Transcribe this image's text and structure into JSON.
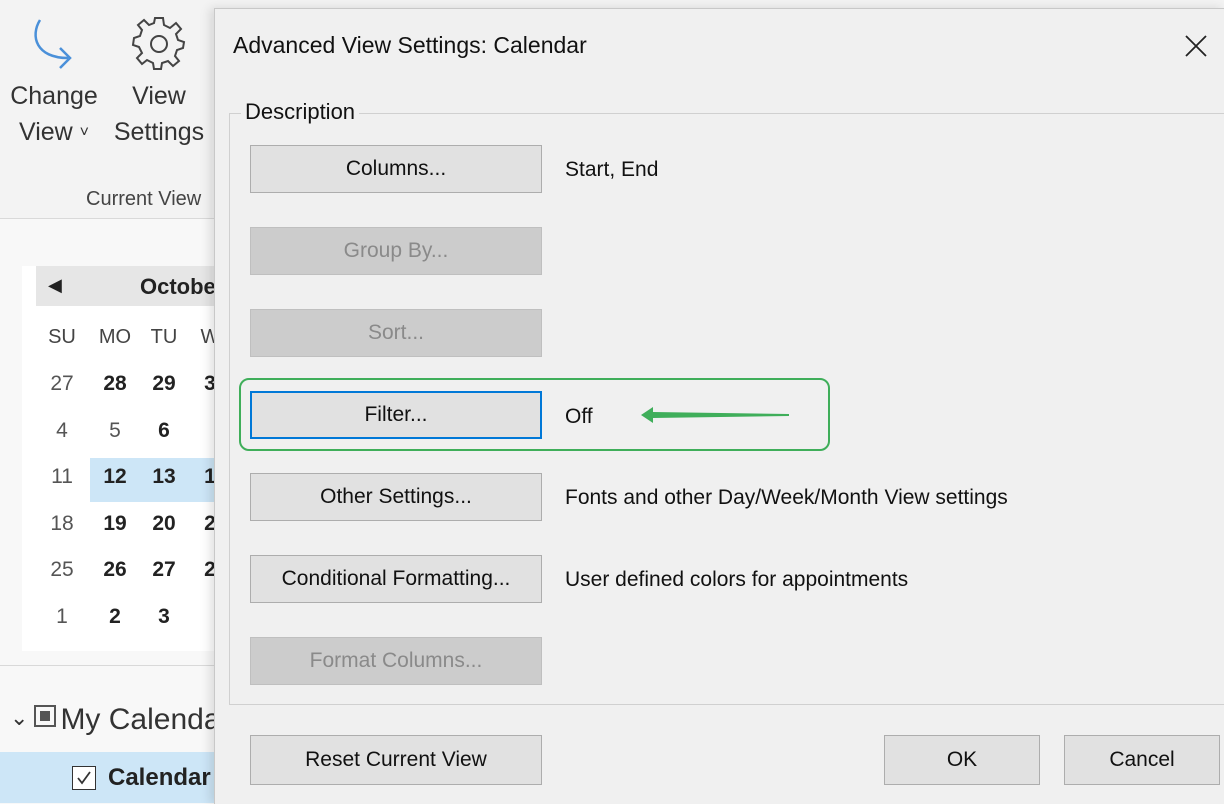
{
  "ribbon": {
    "change_view": {
      "line1": "Change",
      "line2": "View",
      "icon": "curved-arrow-icon"
    },
    "view_settings": {
      "line1": "View",
      "line2": "Settings",
      "icon": "gear-icon"
    },
    "group_label": "Current View"
  },
  "calendar": {
    "month": "October",
    "weekdays": [
      "SU",
      "MO",
      "TU",
      "W"
    ],
    "rows": [
      [
        "27",
        "28",
        "29",
        "3"
      ],
      [
        "4",
        "5",
        "6",
        ""
      ],
      [
        "11",
        "12",
        "13",
        "1"
      ],
      [
        "18",
        "19",
        "20",
        "2"
      ],
      [
        "25",
        "26",
        "27",
        "2"
      ],
      [
        "1",
        "2",
        "3",
        ""
      ]
    ]
  },
  "folders": {
    "group": "My Calendars",
    "item": "Calendar"
  },
  "dialog": {
    "title": "Advanced View Settings: Calendar",
    "group_label": "Description",
    "buttons": {
      "columns": "Columns...",
      "group_by": "Group By...",
      "sort": "Sort...",
      "filter": "Filter...",
      "other_settings": "Other Settings...",
      "conditional_formatting": "Conditional Formatting...",
      "format_columns": "Format Columns..."
    },
    "descriptions": {
      "columns": "Start, End",
      "filter": "Off",
      "other_settings": "Fonts and other Day/Week/Month View settings",
      "conditional_formatting": "User defined colors for appointments"
    },
    "footer": {
      "reset": "Reset Current View",
      "ok": "OK",
      "cancel": "Cancel"
    }
  },
  "colors": {
    "accent": "#0078d7",
    "highlight": "#3fae5a",
    "selection": "#cde6f7"
  }
}
